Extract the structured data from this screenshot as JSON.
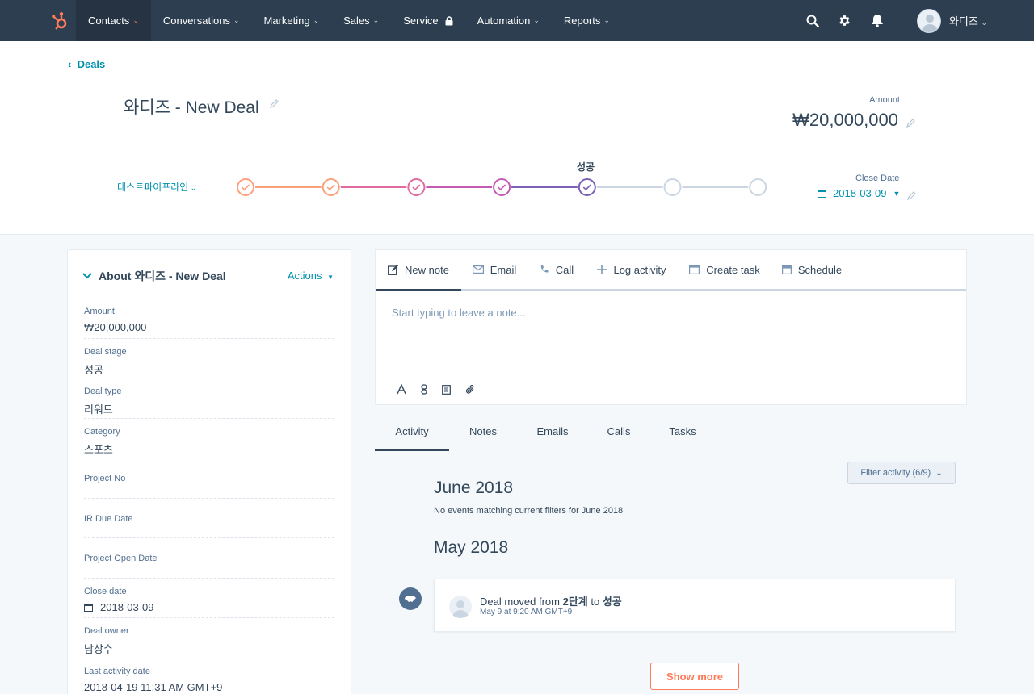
{
  "nav": {
    "items": [
      {
        "label": "Contacts",
        "chevron": true,
        "active": true
      },
      {
        "label": "Conversations",
        "chevron": true
      },
      {
        "label": "Marketing",
        "chevron": true
      },
      {
        "label": "Sales",
        "chevron": true
      },
      {
        "label": "Service",
        "lock": true
      },
      {
        "label": "Automation",
        "chevron": true
      },
      {
        "label": "Reports",
        "chevron": true
      }
    ],
    "user_name": "와디즈",
    "colors": {
      "bar": "#2d3e50",
      "active": "#253342",
      "logo": "#ff7a59"
    }
  },
  "header": {
    "back_label": "Deals",
    "deal_title": "와디즈 - New Deal",
    "amount_label": "Amount",
    "amount_value": "₩20,000,000",
    "pipeline_label": "테스트파이프라인",
    "current_stage_label": "성공",
    "close_date_label": "Close Date",
    "close_date_value": "2018-03-09",
    "pipeline_stages": [
      {
        "completed": true,
        "color": "#ff9f7f"
      },
      {
        "completed": true,
        "color": "#f7a27b"
      },
      {
        "completed": true,
        "color": "#e06c9f"
      },
      {
        "completed": true,
        "color": "#c45bb3"
      },
      {
        "completed": true,
        "current": true,
        "color": "#7b62b5"
      },
      {
        "completed": false,
        "color": "#cbd6e2"
      },
      {
        "completed": false,
        "color": "#cbd6e2"
      }
    ]
  },
  "about": {
    "title": "About 와디즈 - New Deal",
    "actions_label": "Actions",
    "properties": [
      {
        "label": "Amount",
        "value": "₩20,000,000"
      },
      {
        "label": "Deal stage",
        "value": "성공"
      },
      {
        "label": "Deal type",
        "value": "리워드"
      },
      {
        "label": "Category",
        "value": "스포츠"
      },
      {
        "label": "Project No",
        "value": ""
      },
      {
        "label": "IR Due Date",
        "value": ""
      },
      {
        "label": "Project Open Date",
        "value": ""
      },
      {
        "label": "Close date",
        "value": "2018-03-09",
        "icon": "calendar-icon"
      },
      {
        "label": "Deal owner",
        "value": "남상수"
      },
      {
        "label": "Last activity date",
        "value": "2018-04-19 11:31 AM GMT+9"
      }
    ]
  },
  "composer": {
    "tabs": [
      {
        "label": "New note",
        "icon": "edit-note-icon",
        "active": true
      },
      {
        "label": "Email",
        "icon": "envelope-icon"
      },
      {
        "label": "Call",
        "icon": "phone-icon"
      },
      {
        "label": "Log activity",
        "icon": "plus-icon"
      },
      {
        "label": "Create task",
        "icon": "task-icon"
      },
      {
        "label": "Schedule",
        "icon": "calendar-icon"
      }
    ],
    "placeholder": "Start typing to leave a note..."
  },
  "activity": {
    "tabs": [
      {
        "label": "Activity",
        "active": true
      },
      {
        "label": "Notes"
      },
      {
        "label": "Emails"
      },
      {
        "label": "Calls"
      },
      {
        "label": "Tasks"
      }
    ],
    "filter_label": "Filter activity (6/9)",
    "months": [
      {
        "title": "June 2018",
        "note": "No events matching current filters for June 2018"
      },
      {
        "title": "May 2018"
      }
    ],
    "event": {
      "text_prefix": "Deal moved from ",
      "from_stage": "2단계",
      "text_mid": " to ",
      "to_stage": "성공",
      "time": "May 9 at 9:20 AM GMT+9"
    },
    "show_more_label": "Show more"
  }
}
